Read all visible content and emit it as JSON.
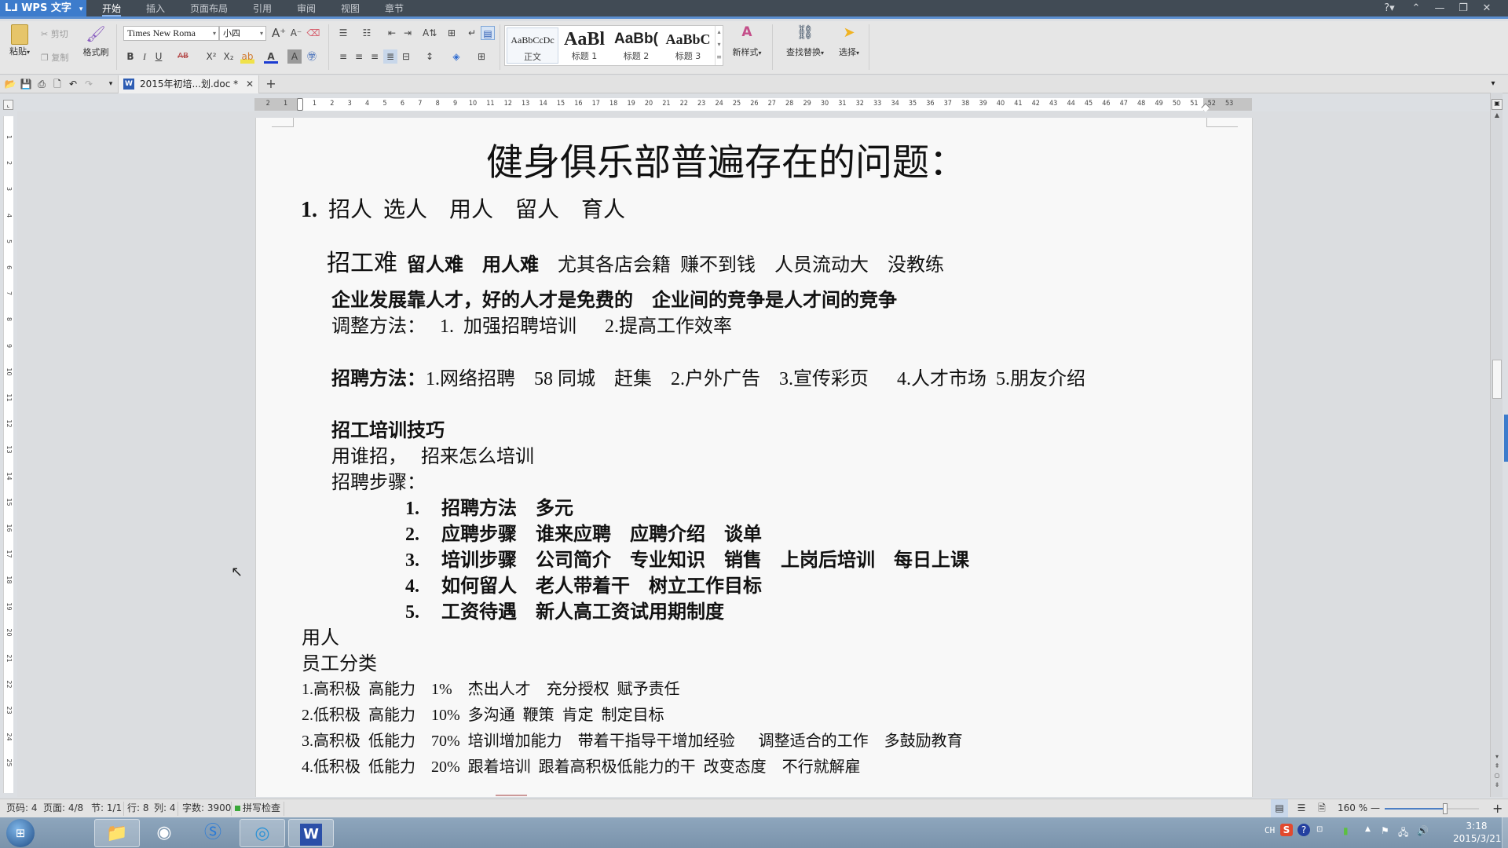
{
  "app": {
    "name": "WPS 文字",
    "menu_tabs": [
      "开始",
      "插入",
      "页面布局",
      "引用",
      "审阅",
      "视图",
      "章节"
    ],
    "active_tab": "开始",
    "window_controls": {
      "help": "?",
      "collapse": "collapse-ribbon",
      "minimize": "minimize",
      "restore": "restore",
      "close": "close"
    }
  },
  "ribbon": {
    "clipboard": {
      "paste": "粘贴",
      "cut": "剪切",
      "copy": "复制",
      "format_painter": "格式刷"
    },
    "font": {
      "family": "Times New Roma",
      "size": "小四",
      "bold": "B",
      "italic": "I",
      "underline": "U",
      "strike": "AB",
      "superscript": "X²",
      "subscript": "X₂"
    },
    "styles": [
      {
        "sample": "AaBbCcDc",
        "label": "正文",
        "selected": true
      },
      {
        "sample": "AaBl",
        "label": "标题 1"
      },
      {
        "sample": "AaBb(",
        "label": "标题 2"
      },
      {
        "sample": "AaBbC",
        "label": "标题 3"
      }
    ],
    "new_style": "新样式",
    "find_replace": "查找替换",
    "select": "选择"
  },
  "document_tab": {
    "title": "2015年初培...划.doc *"
  },
  "ruler": {
    "left_margin_ticks": [
      "2",
      "1"
    ],
    "ticks": [
      "1",
      "2",
      "3",
      "4",
      "5",
      "6",
      "7",
      "8",
      "9",
      "10",
      "11",
      "12",
      "13",
      "14",
      "15",
      "16",
      "17",
      "18",
      "19",
      "20",
      "21",
      "22",
      "23",
      "24",
      "25",
      "26",
      "27",
      "28",
      "29",
      "30",
      "31",
      "32",
      "33",
      "34",
      "35",
      "36",
      "37",
      "38",
      "39",
      "40",
      "41",
      "42",
      "43",
      "44",
      "45",
      "46",
      "47",
      "48",
      "49",
      "50",
      "51"
    ],
    "right_margin_ticks": [
      "52",
      "53"
    ],
    "vertical_ticks": [
      "1",
      "2",
      "3",
      "4",
      "5",
      "6",
      "7",
      "8",
      "9",
      "10",
      "11",
      "12",
      "13",
      "14",
      "15",
      "16",
      "17",
      "18",
      "19",
      "20",
      "21",
      "22",
      "23",
      "24",
      "25"
    ]
  },
  "document": {
    "title": "健身俱乐部普遍存在的问题：",
    "item1": {
      "num": "1.",
      "text": "招人  选人    用人    留人    育人"
    },
    "difficulties": {
      "lead": "招工难",
      "bold_part": "  留人难    用人难",
      "rest": "    尤其各店会籍  赚不到钱    人员流动大    没教练"
    },
    "talent": "企业发展靠人才，好的人才是免费的    企业间的竞争是人才间的竞争",
    "adjust": "调整方法：   1.  加强招聘培训      2.提高工作效率",
    "recruit_methods": {
      "label": "招聘方法：",
      "text": "1.网络招聘    58 同城    赶集    2.户外广告    3.宣传彩页      4.人才市场  5.朋友介绍"
    },
    "training_title": "招工培训技巧",
    "who": "用谁招，   招来怎么培训",
    "steps_title": "招聘步骤：",
    "steps": [
      {
        "num": "1.",
        "text": "招聘方法    多元"
      },
      {
        "num": "2.",
        "text": "应聘步骤    谁来应聘    应聘介绍    谈单"
      },
      {
        "num": "3.",
        "text": "培训步骤    公司简介    专业知识    销售    上岗后培训    每日上课"
      },
      {
        "num": "4.",
        "text": "如何留人    老人带着干    树立工作目标"
      },
      {
        "num": "5.",
        "text": "工资待遇    新人高工资试用期制度"
      }
    ],
    "use_people": "用人",
    "classification_title": "员工分类",
    "classes": [
      "1.高积极  高能力    1%    杰出人才    充分授权  赋予责任",
      "2.低积极  高能力    10%  多沟通  鞭策  肯定  制定目标",
      "3.高积极  低能力    70%  培训增加能力    带着干指导干增加经验      调整适合的工作    多鼓励教育",
      "4.低积极  低能力    20%  跟着培训  跟着高积极低能力的干  改变态度    不行就解雇"
    ]
  },
  "statusbar": {
    "page_code": "页码: 4",
    "page": "页面: 4/8",
    "section": "节: 1/1",
    "row": "行: 8",
    "col": "列: 4",
    "word_count": "字数: 3900",
    "spell_check": "拼写检查",
    "zoom": "160 %",
    "zoom_minus": "—",
    "zoom_plus": "+"
  },
  "taskbar": {
    "apps": [
      "start",
      "file-explorer",
      "weibo",
      "sogou-browser",
      "360-browser",
      "wps-writer"
    ],
    "tray": {
      "ime": "CH"
    },
    "time": "3:18",
    "date": "2015/3/21"
  },
  "colors": {
    "accent": "#3d7ccc",
    "titlebar": "#414b55",
    "page": "#f8f8f8"
  }
}
